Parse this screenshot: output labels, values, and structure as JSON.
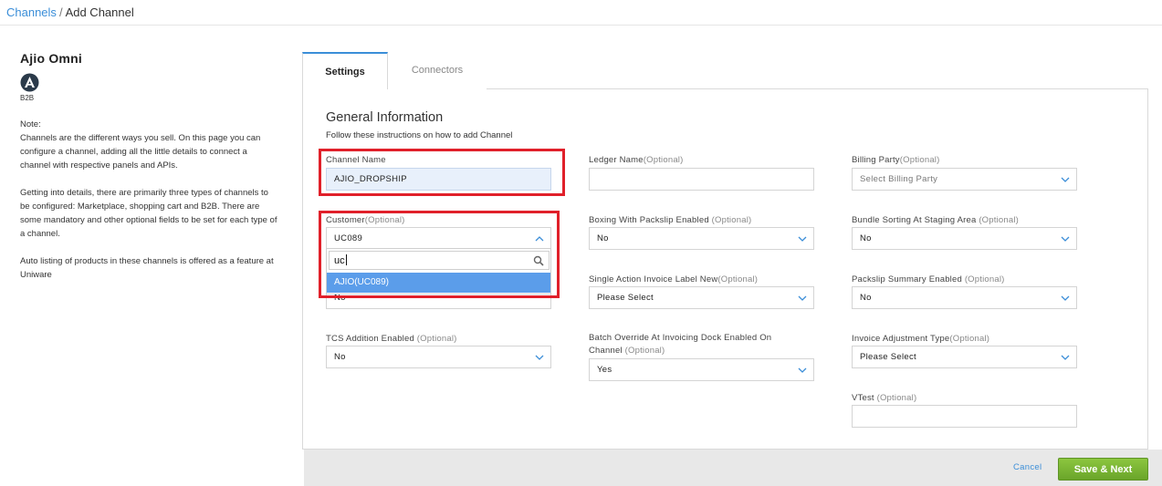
{
  "breadcrumb": {
    "parent": "Channels",
    "separator": "/",
    "current": "Add Channel"
  },
  "channel": {
    "name": "Ajio Omni",
    "type": "B2B"
  },
  "note": {
    "title": "Note:",
    "p1": "Channels are the different ways you sell. On this page you can configure a channel, adding all the little details to connect a channel with respective panels and APIs.",
    "p2": "Getting into details, there are primarily three types of channels to be configured: Marketplace, shopping cart and B2B. There are some mandatory and other optional fields to be set for each type of a channel.",
    "p3": "Auto listing of products in these channels is offered as a feature at Uniware"
  },
  "tabs": {
    "settings": "Settings",
    "connectors": "Connectors"
  },
  "section": {
    "title": "General Information",
    "subtitle": "Follow these instructions on how to add Channel"
  },
  "fields": {
    "channel_name": {
      "label": "Channel Name",
      "value": "AJIO_DROPSHIP"
    },
    "ledger_name": {
      "label": "Ledger Name",
      "opt": "(Optional)",
      "value": ""
    },
    "billing_party": {
      "label": "Billing Party",
      "opt": "(Optional)",
      "value": "Select Billing Party"
    },
    "customer": {
      "label": "Customer",
      "opt": "(Optional)",
      "value": "UC089",
      "search": "uc",
      "option": "AJIO(UC089)"
    },
    "hidden_field": {
      "value": "No"
    },
    "boxing": {
      "label": "Boxing With Packslip Enabled",
      "opt": "(Optional)",
      "value": "No"
    },
    "bundle_sorting": {
      "label": "Bundle Sorting At Staging Area",
      "opt": "(Optional)",
      "value": "No"
    },
    "single_action": {
      "label": "Single Action Invoice Label New",
      "opt": "(Optional)",
      "value": "Please Select"
    },
    "packslip_summary": {
      "label": "Packslip Summary Enabled",
      "opt": "(Optional)",
      "value": "No"
    },
    "tcs": {
      "label": "TCS Addition Enabled",
      "opt": "(Optional)",
      "value": "No"
    },
    "batch_override": {
      "label1": "Batch Override At Invoicing Dock Enabled On",
      "label2": "Channel",
      "opt": "(Optional)",
      "value": "Yes"
    },
    "invoice_adjustment": {
      "label": "Invoice Adjustment Type",
      "opt": "(Optional)",
      "value": "Please Select"
    },
    "vtest": {
      "label": "VTest",
      "opt": "(Optional)",
      "value": ""
    }
  },
  "footer": {
    "cancel": "Cancel",
    "save": "Save & Next"
  },
  "colors": {
    "link": "#3b8ed8",
    "highlight": "#e0202a",
    "selected_option": "#5b9dea",
    "save_button": "#7cb83a"
  }
}
